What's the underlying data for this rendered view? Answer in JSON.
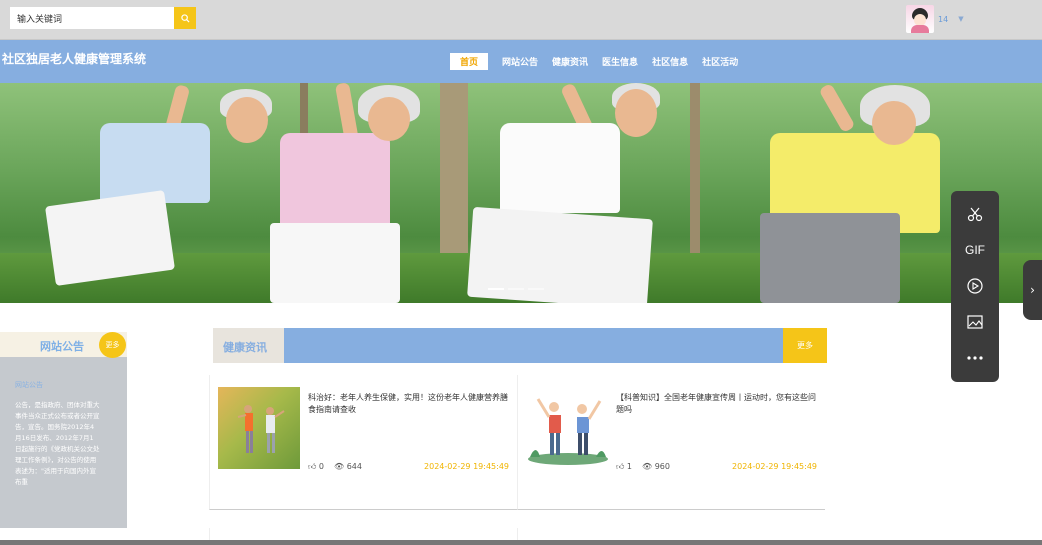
{
  "search": {
    "placeholder": "输入关键词",
    "value": "输入关键词"
  },
  "user": {
    "name": "14"
  },
  "brand": {
    "title": "社区独居老人健康管理系统"
  },
  "nav": {
    "items": [
      {
        "label": "首页",
        "active": true
      },
      {
        "label": "网站公告"
      },
      {
        "label": "健康资讯"
      },
      {
        "label": "医生信息"
      },
      {
        "label": "社区信息"
      },
      {
        "label": "社区活动"
      }
    ]
  },
  "notice": {
    "title": "网站公告",
    "more": "更多",
    "subtitle": "网站公告",
    "body": "公告，是指政府、团体对重大事件当众正式公布或者公开宣告，宣告。国务院2012年4月16日发布、2012年7月1日起施行的《党政机关公文处理工作条例》，对公告的使用表述为：\"适用于向国内外宣布重"
  },
  "news": {
    "title": "健康资讯",
    "more": "更多",
    "items": [
      {
        "title": "科治好：老年人养生保健，实用！这份老年人健康营养膳食指南请查收",
        "likes": "0",
        "views": "644",
        "date": "2024-02-29 19:45:49"
      },
      {
        "title": "【科普知识】全国老年健康宣传周丨运动时，您有这些问题吗",
        "likes": "1",
        "views": "960",
        "date": "2024-02-29 19:45:49"
      }
    ]
  },
  "toolbar": {
    "gif_label": "GIF"
  },
  "colors": {
    "nav": "#86aee0",
    "accent": "#f5c518",
    "topbar": "#d9d9d9"
  }
}
